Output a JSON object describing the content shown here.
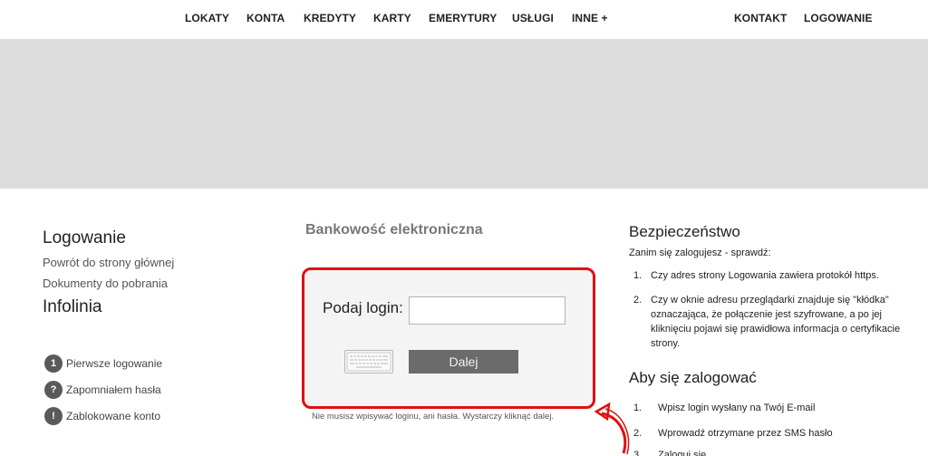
{
  "nav": {
    "left_items": [
      "LOKATY",
      "KONTA",
      "KREDYTY",
      "KARTY",
      "EMERYTURY",
      "USŁUGI",
      "INNE +"
    ],
    "contact": "KONTAKT",
    "login": "LOGOWANIE"
  },
  "left": {
    "title": "Logowanie",
    "links": [
      "Powrót do strony głównej",
      "Dokumenty do pobrania"
    ],
    "infolinia": "Infolinia",
    "help": [
      {
        "badge": "1",
        "label": "Pierwsze logowanie"
      },
      {
        "badge": "?",
        "label": "Zapomniałem hasła"
      },
      {
        "badge": "!",
        "label": "Zablokowane konto"
      }
    ]
  },
  "middle": {
    "title": "Bankowość elektroniczna",
    "login_label": "Podaj login:",
    "login_value": "",
    "next_button": "Dalej",
    "hint": "Nie musisz wpisywać loginu, ani hasła. Wystarczy kliknąć dalej."
  },
  "right": {
    "security_title": "Bezpieczeństwo",
    "security_sub": "Zanim się zalogujesz - sprawdź:",
    "security_items": [
      {
        "num": "1.",
        "text": "Czy adres strony Logowania zawiera protokół https."
      },
      {
        "num": "2.",
        "text": "Czy w oknie adresu przeglądarki znajduje się \"kłódka\" oznaczająca, że połączenie jest szyfrowane, a po jej kliknięciu pojawi się prawidłowa informacja o certyfikacie strony."
      }
    ],
    "howto_title": "Aby się zalogować",
    "howto_items": [
      {
        "num": "1.",
        "text": "Wpisz login wysłany na Twój E-mail"
      },
      {
        "num": "2.",
        "text": "Wprowadź otrzymane przez SMS hasło"
      },
      {
        "num": "3.",
        "text": "Zaloguj się"
      }
    ]
  },
  "colors": {
    "highlight_border": "#e01010",
    "banner": "#dcdcdc",
    "button": "#6b6b6b"
  }
}
